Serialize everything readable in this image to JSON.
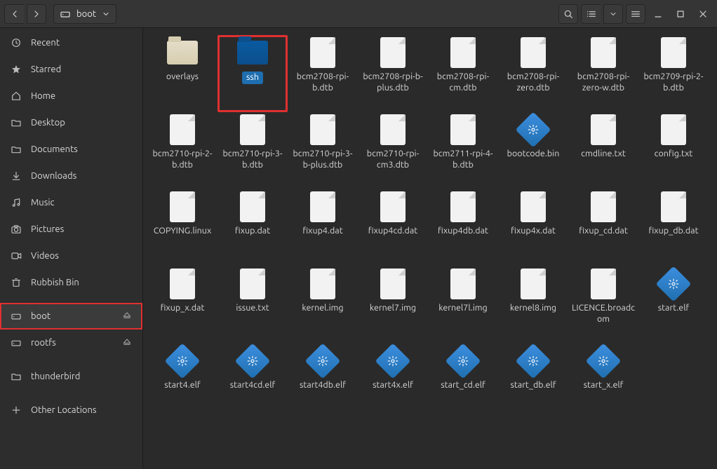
{
  "header": {
    "path_label": "boot"
  },
  "sidebar": {
    "items": [
      {
        "icon": "clock",
        "label": "Recent"
      },
      {
        "icon": "star",
        "label": "Starred"
      },
      {
        "icon": "home",
        "label": "Home"
      },
      {
        "icon": "folder",
        "label": "Desktop"
      },
      {
        "icon": "folder",
        "label": "Documents"
      },
      {
        "icon": "download",
        "label": "Downloads"
      },
      {
        "icon": "music",
        "label": "Music"
      },
      {
        "icon": "camera",
        "label": "Pictures"
      },
      {
        "icon": "video",
        "label": "Videos"
      },
      {
        "icon": "trash",
        "label": "Rubbish Bin"
      },
      {
        "icon": "drive",
        "label": "boot",
        "eject": true,
        "active": true,
        "highlight": true
      },
      {
        "icon": "drive",
        "label": "rootfs",
        "eject": true
      },
      {
        "icon": "folder",
        "label": "thunderbird"
      },
      {
        "icon": "plus",
        "label": "Other Locations"
      }
    ]
  },
  "files": [
    {
      "name": "overlays",
      "kind": "folder-beige"
    },
    {
      "name": "ssh",
      "kind": "folder-blue",
      "selected": true,
      "highlight": true
    },
    {
      "name": "bcm2708-rpi-b.dtb",
      "kind": "file"
    },
    {
      "name": "bcm2708-rpi-b-plus.dtb",
      "kind": "file"
    },
    {
      "name": "bcm2708-rpi-cm.dtb",
      "kind": "file"
    },
    {
      "name": "bcm2708-rpi-zero.dtb",
      "kind": "file"
    },
    {
      "name": "bcm2708-rpi-zero-w.dtb",
      "kind": "file"
    },
    {
      "name": "bcm2709-rpi-2-b.dtb",
      "kind": "file"
    },
    {
      "name": "bcm2710-rpi-2-b.dtb",
      "kind": "file"
    },
    {
      "name": "bcm2710-rpi-3-b.dtb",
      "kind": "file"
    },
    {
      "name": "bcm2710-rpi-3-b-plus.dtb",
      "kind": "file"
    },
    {
      "name": "bcm2710-rpi-cm3.dtb",
      "kind": "file"
    },
    {
      "name": "bcm2711-rpi-4-b.dtb",
      "kind": "file"
    },
    {
      "name": "bootcode.bin",
      "kind": "exec"
    },
    {
      "name": "cmdline.txt",
      "kind": "file"
    },
    {
      "name": "config.txt",
      "kind": "file"
    },
    {
      "name": "COPYING.linux",
      "kind": "file"
    },
    {
      "name": "fixup.dat",
      "kind": "file"
    },
    {
      "name": "fixup4.dat",
      "kind": "file"
    },
    {
      "name": "fixup4cd.dat",
      "kind": "file"
    },
    {
      "name": "fixup4db.dat",
      "kind": "file"
    },
    {
      "name": "fixup4x.dat",
      "kind": "file"
    },
    {
      "name": "fixup_cd.dat",
      "kind": "file"
    },
    {
      "name": "fixup_db.dat",
      "kind": "file"
    },
    {
      "name": "fixup_x.dat",
      "kind": "file"
    },
    {
      "name": "issue.txt",
      "kind": "file"
    },
    {
      "name": "kernel.img",
      "kind": "file"
    },
    {
      "name": "kernel7.img",
      "kind": "file"
    },
    {
      "name": "kernel7l.img",
      "kind": "file"
    },
    {
      "name": "kernel8.img",
      "kind": "file"
    },
    {
      "name": "LICENCE.broadcom",
      "kind": "file"
    },
    {
      "name": "start.elf",
      "kind": "exec"
    },
    {
      "name": "start4.elf",
      "kind": "exec"
    },
    {
      "name": "start4cd.elf",
      "kind": "exec"
    },
    {
      "name": "start4db.elf",
      "kind": "exec"
    },
    {
      "name": "start4x.elf",
      "kind": "exec"
    },
    {
      "name": "start_cd.elf",
      "kind": "exec"
    },
    {
      "name": "start_db.elf",
      "kind": "exec"
    },
    {
      "name": "start_x.elf",
      "kind": "exec"
    }
  ]
}
